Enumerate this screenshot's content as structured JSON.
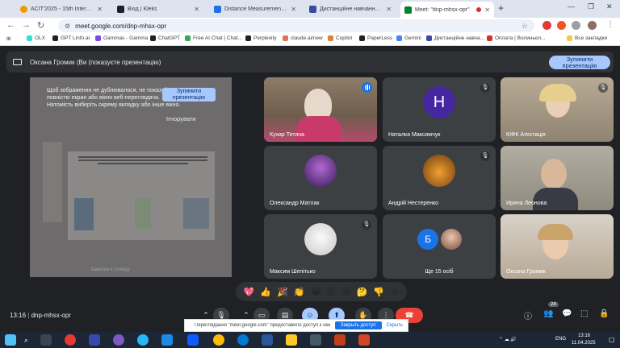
{
  "browser": {
    "tabs": [
      {
        "title": "ACIT'2025 - 15th International",
        "color": "#f29900"
      },
      {
        "title": "Вхід | Kleks",
        "color": "#202124"
      },
      {
        "title": "Distance Measurement using A",
        "color": "#1a73e8"
      },
      {
        "title": "Дистанційне навчання в ВСП",
        "color": "#3c4b9e"
      },
      {
        "title": "Meet: \"dnp-mhsx-opr\"",
        "color": "#00832d"
      }
    ],
    "new_tab_label": "+",
    "url": "meet.google.com/dnp-mhsx-opr",
    "bookmarks": [
      {
        "label": "OLX",
        "color": "#23e5db"
      },
      {
        "label": "GPT Linfo.ai",
        "color": "#202124"
      },
      {
        "label": "Gammas - Gamma",
        "color": "#7a4be8"
      },
      {
        "label": "ChatGPT",
        "color": "#202124"
      },
      {
        "label": "Free AI Chat | Chat...",
        "color": "#34a853"
      },
      {
        "label": "Perplexity",
        "color": "#202124"
      },
      {
        "label": "claude.ai/new",
        "color": "#d97757"
      },
      {
        "label": "Copilot",
        "color": "#e0803a"
      },
      {
        "label": "PaperLess",
        "color": "#202124"
      },
      {
        "label": "Gemini",
        "color": "#4285f4"
      },
      {
        "label": "Дистанційне навча...",
        "color": "#3c4b9e"
      },
      {
        "label": "Оплата | Волиньел...",
        "color": "#d93025"
      }
    ],
    "all_bookmarks": "Все закладки"
  },
  "meet": {
    "presenting_banner": "Оксана Громик (Ви (показуєте презентацію)",
    "stop_presenting": "Зупинити презентацію",
    "share_warning": "Щоб зображення не дублювалося, не показуйте повністю екран або вікно веб-переглядача. Натомість виберіть окрему вкладку або інше вікно.",
    "share_stop": "Зупинити презентацію",
    "share_ignore": "Ігнорувати",
    "notes_placeholder": "Заметки к слайду",
    "participants": [
      {
        "name": "Кухар Тетяна",
        "speaking": true,
        "muted": false,
        "type": "video",
        "bg": "#7a6b5a"
      },
      {
        "name": "Наталка Максимчук",
        "muted": true,
        "type": "initial",
        "initial": "Н",
        "avatar_color": "#4527a0"
      },
      {
        "name": "КІФК Атестація",
        "muted": true,
        "type": "video",
        "bg": "#9a8c7a"
      },
      {
        "name": "Олександр Матлак",
        "muted": false,
        "type": "photo",
        "avatar_color": "#5b3a7a"
      },
      {
        "name": "Андрій Нестеренко",
        "muted": true,
        "type": "photo",
        "avatar_color": "#d88a2b"
      },
      {
        "name": "Ирина Леонова",
        "muted": false,
        "type": "video",
        "bg": "#8a8a80"
      },
      {
        "name": "Максим Шепітько",
        "muted": true,
        "type": "photo",
        "avatar_color": "#e8e8e8"
      },
      {
        "name": "Ще 15 осіб",
        "muted": false,
        "type": "more",
        "initial": "Б",
        "avatar_color": "#1a73e8"
      },
      {
        "name": "Оксана Громик",
        "muted": false,
        "type": "video",
        "bg": "#c8b6a0"
      }
    ],
    "reactions": [
      "💖",
      "👍",
      "🎉",
      "👏",
      "😂",
      "😮",
      "😢",
      "🤔",
      "👎",
      "☺"
    ],
    "meeting_time": "13:16",
    "meeting_code": "dnp-mhsx-opr",
    "participants_count": "24"
  },
  "notification": {
    "message": "Переглядання \"meet.google.com\" предоставило доступ к окну",
    "stop_button": "Закрыть доступ",
    "hide_button": "Скрыть"
  },
  "taskbar": {
    "language": "ENG",
    "time": "13:16",
    "date": "11.04.2025"
  }
}
